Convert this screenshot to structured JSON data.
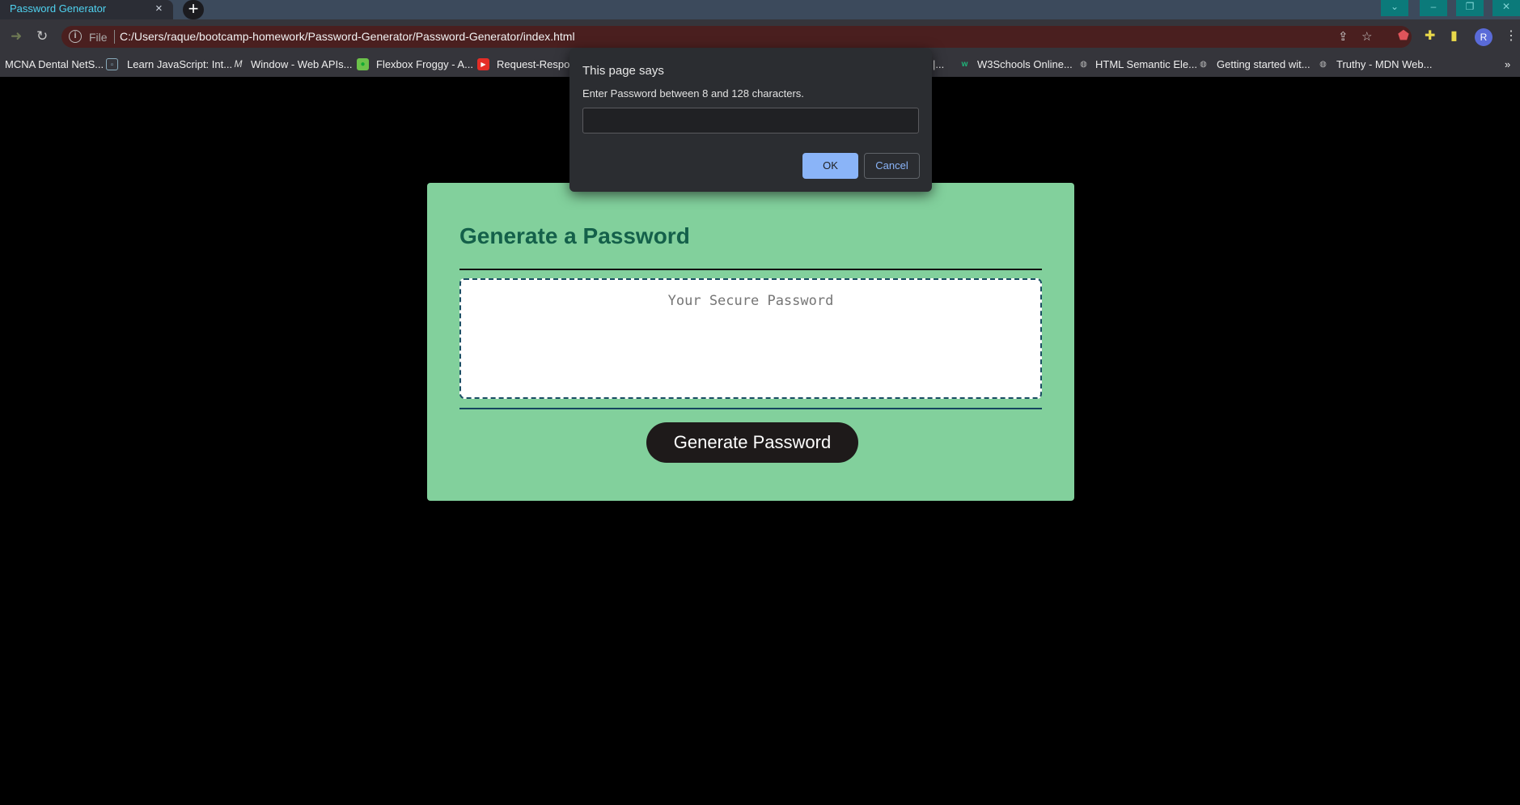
{
  "browser": {
    "tab_title": "Password Generator",
    "tab_close": "×",
    "new_tab": "+",
    "url_scheme_label": "File",
    "url": "C:/Users/raque/bootcamp-homework/Password-Generator/Password-Generator/index.html",
    "avatar_letter": "R",
    "bookmarks_overflow": "»"
  },
  "bookmarks": [
    {
      "label": "MCNA Dental NetS...",
      "icon": "mcna-icon"
    },
    {
      "label": "Learn JavaScript: Int...",
      "icon": "page-icon"
    },
    {
      "label": "Window - Web APIs...",
      "icon": "mdn-icon"
    },
    {
      "label": "Flexbox Froggy - A...",
      "icon": "frog-icon"
    },
    {
      "label": "Request-Respons",
      "icon": "youtube-icon"
    },
    {
      "label": "|...",
      "icon": ""
    },
    {
      "label": "W3Schools Online...",
      "icon": "w3schools-icon"
    },
    {
      "label": "HTML Semantic Ele...",
      "icon": "globe-icon"
    },
    {
      "label": "Getting started wit...",
      "icon": "globe-icon"
    },
    {
      "label": "Truthy - MDN Web...",
      "icon": "globe-icon"
    }
  ],
  "page": {
    "heading": "Generate a Password",
    "password_placeholder": "Your Secure Password",
    "generate_button": "Generate Password"
  },
  "dialog": {
    "title": "This page says",
    "message": "Enter Password between 8 and 128 characters.",
    "input_value": "",
    "ok_label": "OK",
    "cancel_label": "Cancel"
  },
  "colors": {
    "card_background": "#82d09c",
    "heading_color": "#14604a",
    "button_background": "#1e1a1a",
    "dialog_ok": "#8ab4f8"
  }
}
